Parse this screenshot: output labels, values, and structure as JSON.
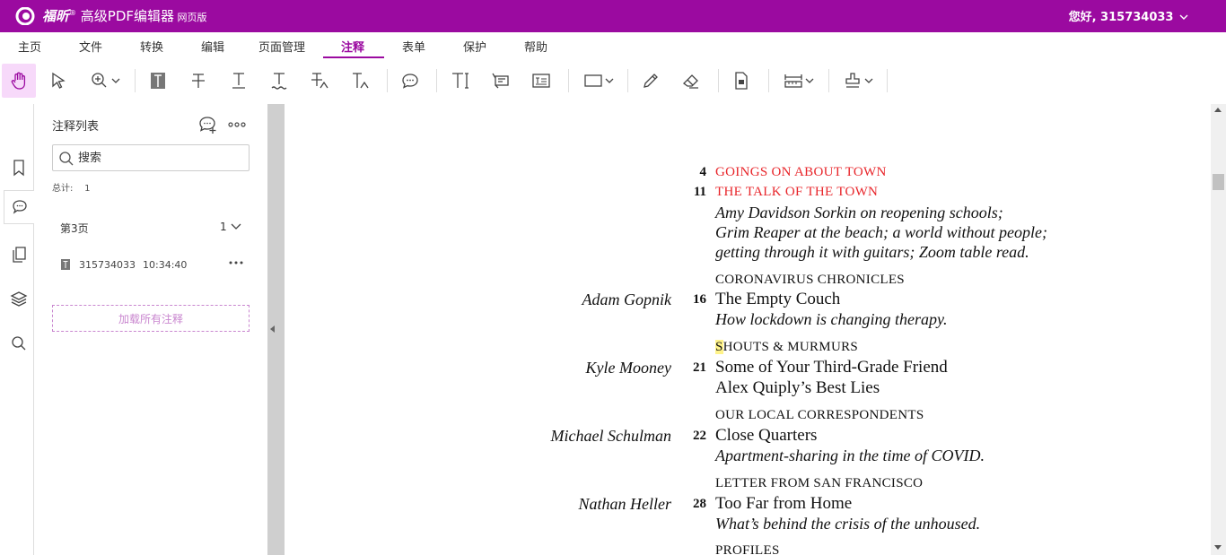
{
  "app": {
    "brand": "福昕",
    "reg": "®",
    "name": " 高级PDF编辑器",
    "suffix": " 网页版"
  },
  "user": {
    "greeting": "您好, 315734033",
    "chevron": "chevron-down-icon"
  },
  "menu": {
    "tabs": [
      {
        "label": "主页"
      },
      {
        "label": "文件"
      },
      {
        "label": "转换"
      },
      {
        "label": "编辑"
      },
      {
        "label": "页面管理"
      },
      {
        "label": "注释"
      },
      {
        "label": "表单"
      },
      {
        "label": "保护"
      },
      {
        "label": "帮助"
      }
    ],
    "active_index": 5
  },
  "colors": {
    "brand": "#9b0aa0",
    "active_tool_bg": "#f7d9fa",
    "red_heading": "#e8262b",
    "highlight": "#fff38a"
  },
  "toolbar": {
    "icons": [
      "hand-icon",
      "select-arrow-icon",
      "zoom-icon",
      "highlight-text-icon",
      "strikeout-icon",
      "underline-icon",
      "squiggly-icon",
      "replace-text-icon",
      "insert-text-icon",
      "comment-icon",
      "typewriter-icon",
      "callout-icon",
      "textbox-icon",
      "rectangle-icon",
      "pencil-icon",
      "eraser-icon",
      "attach-file-icon",
      "measure-icon",
      "stamp-icon"
    ]
  },
  "sidebar": {
    "rail_icons": [
      "bookmark-icon",
      "comments-icon",
      "pages-icon",
      "layers-icon",
      "search-icon"
    ],
    "title": "注释列表",
    "search_placeholder": "搜索",
    "total_label": "总计:",
    "total_value": "1",
    "page_group": "第3页",
    "group_count": "1",
    "annotation": {
      "author": "315734033",
      "time": "10:34:40"
    },
    "load_all": "加载所有注释"
  },
  "document": {
    "entries": [
      {
        "num": "4",
        "section": "GOINGS ON ABOUT TOWN",
        "red": true
      },
      {
        "num": "11",
        "section": "THE TALK OF THE TOWN",
        "red": true
      },
      {
        "desc": "Amy Davidson Sorkin on reopening schools;"
      },
      {
        "desc": "Grim Reaper at the beach; a world without people;"
      },
      {
        "desc": "getting through it with guitars; Zoom table read."
      },
      {
        "section": "CORONAVIRUS CHRONICLES"
      },
      {
        "author": "Adam Gopnik",
        "num": "16",
        "title": "The Empty Couch"
      },
      {
        "desc": "How lockdown is changing therapy."
      },
      {
        "section_hl": "S",
        "section": "HOUTS & MURMURS"
      },
      {
        "author": "Kyle Mooney",
        "num": "21",
        "title": "Some of Your Third-Grade Friend"
      },
      {
        "title": "Alex Quiply’s Best Lies"
      },
      {
        "section": "OUR LOCAL CORRESPONDENTS"
      },
      {
        "author": "Michael Schulman",
        "num": "22",
        "title": "Close Quarters"
      },
      {
        "desc": "Apartment-sharing in the time of COVID."
      },
      {
        "section": "LETTER FROM SAN FRANCISCO"
      },
      {
        "author": "Nathan Heller",
        "num": "28",
        "title": "Too Far from Home"
      },
      {
        "desc": "What’s behind the crisis of the unhoused."
      },
      {
        "section": "PROFILES"
      }
    ]
  }
}
